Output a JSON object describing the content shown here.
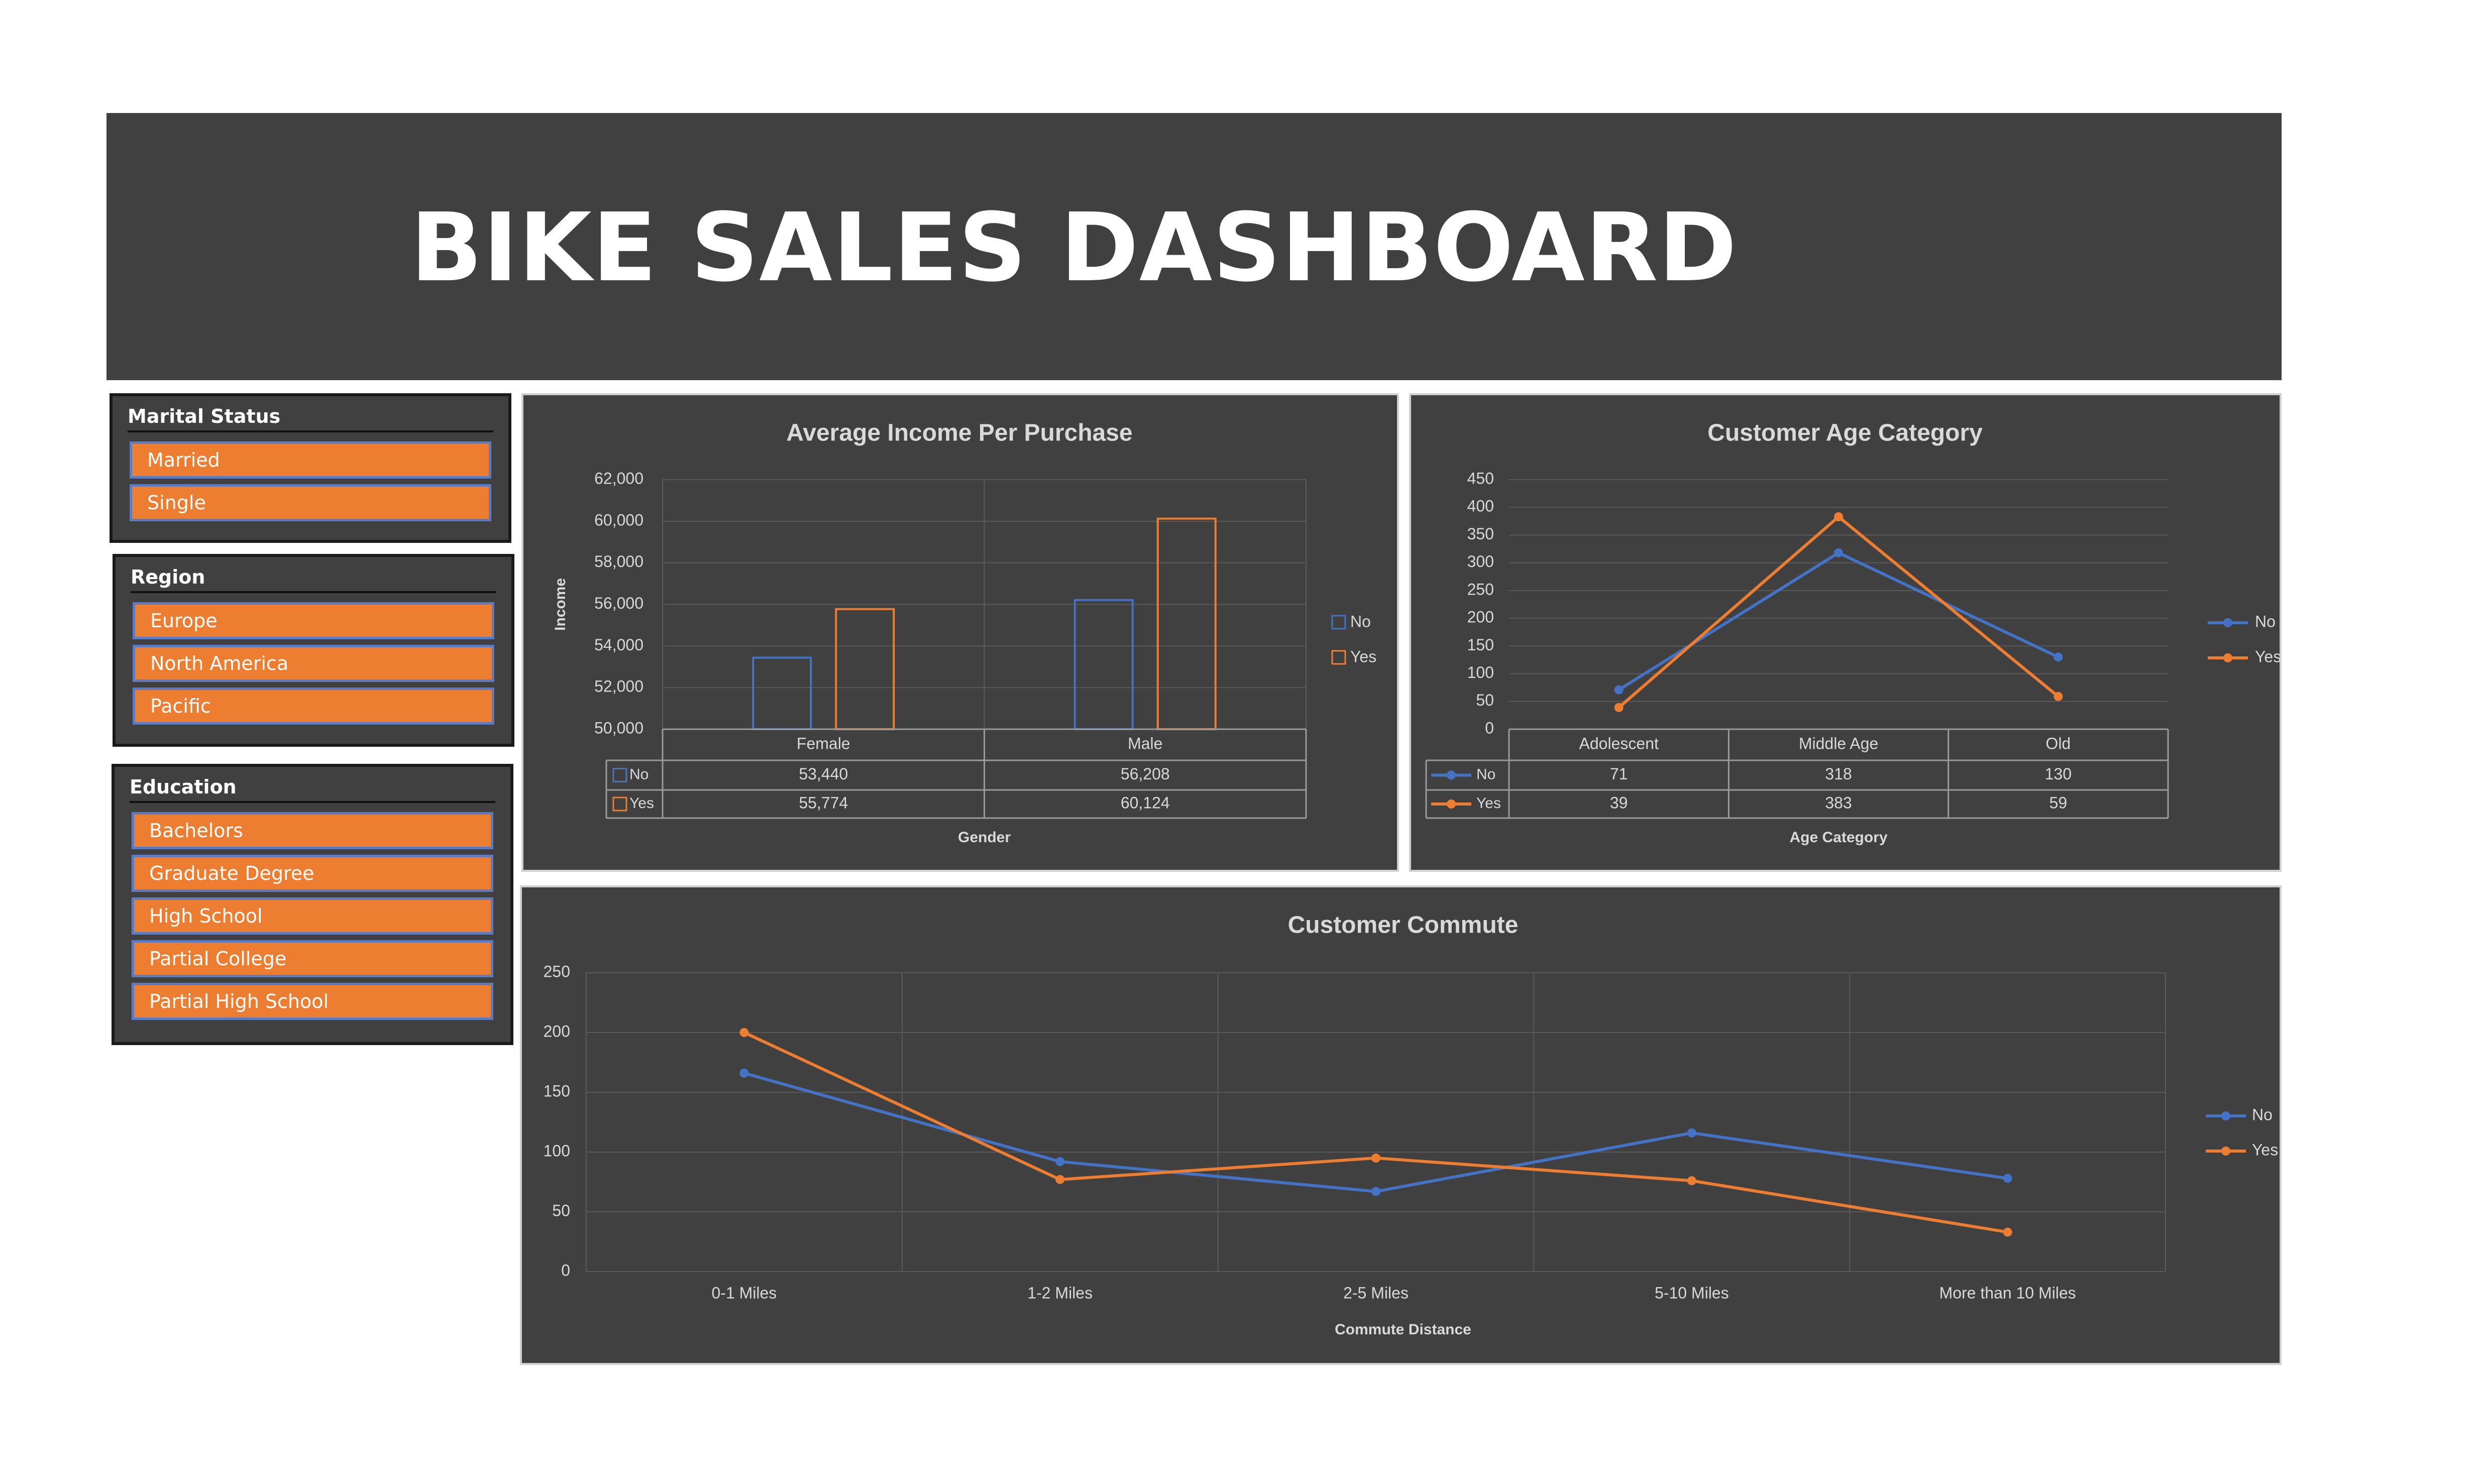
{
  "dashboard": {
    "title": "BIKE SALES DASHBOARD"
  },
  "slicers": {
    "marital": {
      "header": "Marital Status",
      "items": [
        "Married",
        "Single"
      ]
    },
    "region": {
      "header": "Region",
      "items": [
        "Europe",
        "North America",
        "Pacific"
      ]
    },
    "education": {
      "header": "Education",
      "items": [
        "Bachelors",
        "Graduate Degree",
        "High School",
        "Partial College",
        "Partial High School"
      ]
    }
  },
  "colors": {
    "banner": "#404040",
    "panel": "#404040",
    "accent": "#ed7d31",
    "no": "#4472c4",
    "yes": "#ed7d31"
  },
  "chart_data": [
    {
      "type": "bar",
      "title": "Average Income Per Purchase",
      "xlabel": "Gender",
      "ylabel": "Income",
      "categories": [
        "Female",
        "Male"
      ],
      "series": [
        {
          "name": "No",
          "values": [
            53440,
            56208
          ],
          "labels": [
            "53,440",
            "56,208"
          ]
        },
        {
          "name": "Yes",
          "values": [
            55774,
            60124
          ],
          "labels": [
            "55,774",
            "60,124"
          ]
        }
      ],
      "ylim": [
        50000,
        62000
      ],
      "yticks": [
        "50,000",
        "52,000",
        "54,000",
        "56,000",
        "58,000",
        "60,000",
        "62,000"
      ],
      "grid": true,
      "legend": "right"
    },
    {
      "type": "line",
      "title": "Customer Age Category",
      "xlabel": "Age Category",
      "ylabel": "",
      "categories": [
        "Adolescent",
        "Middle Age",
        "Old"
      ],
      "series": [
        {
          "name": "No",
          "values": [
            71,
            318,
            130
          ],
          "labels": [
            "71",
            "318",
            "130"
          ]
        },
        {
          "name": "Yes",
          "values": [
            39,
            383,
            59
          ],
          "labels": [
            "39",
            "383",
            "59"
          ]
        }
      ],
      "ylim": [
        0,
        450
      ],
      "yticks": [
        "0",
        "50",
        "100",
        "150",
        "200",
        "250",
        "300",
        "350",
        "400",
        "450"
      ],
      "grid": true,
      "legend": "right"
    },
    {
      "type": "line",
      "title": "Customer Commute",
      "xlabel": "Commute Distance",
      "ylabel": "",
      "categories": [
        "0-1 Miles",
        "1-2 Miles",
        "2-5 Miles",
        "5-10 Miles",
        "More than 10 Miles"
      ],
      "series": [
        {
          "name": "No",
          "values": [
            166,
            92,
            67,
            116,
            78
          ]
        },
        {
          "name": "Yes",
          "values": [
            200,
            77,
            95,
            76,
            33
          ]
        }
      ],
      "ylim": [
        0,
        250
      ],
      "yticks": [
        "0",
        "50",
        "100",
        "150",
        "200",
        "250"
      ],
      "grid": true,
      "legend": "right"
    }
  ]
}
